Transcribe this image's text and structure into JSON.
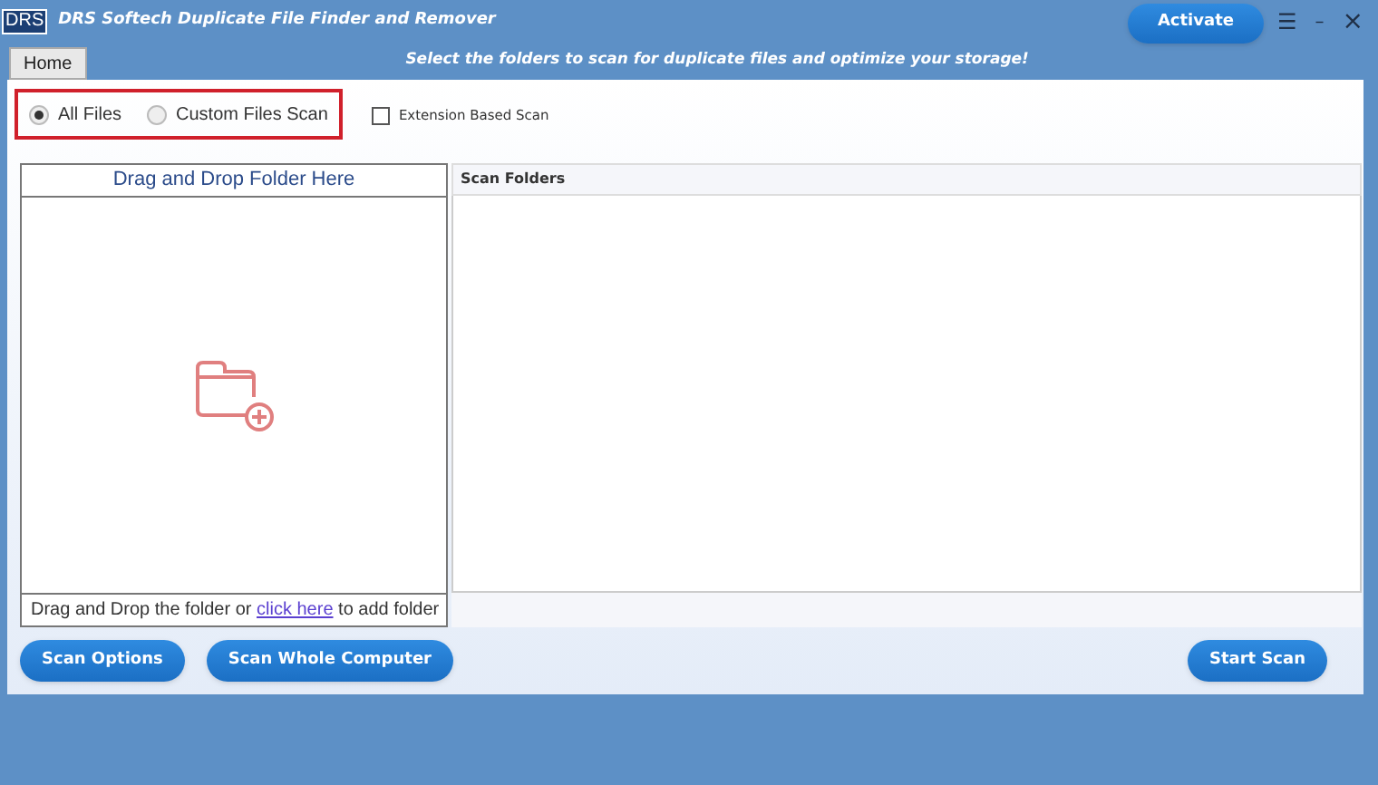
{
  "window": {
    "logo": "DRS",
    "title": "DRS Softech Duplicate File Finder and Remover",
    "activate_button": "Activate",
    "menu_icon": "☰",
    "minimize_icon": "–",
    "close_icon": "×"
  },
  "home_tab": {
    "label": "Home",
    "selected": true
  },
  "tagline": "Select the folders to scan for duplicate files and optimize your storage!",
  "scan_modes": [
    {
      "label": "All Files",
      "selected": true
    },
    {
      "label": "Custom Files Scan",
      "selected": false
    }
  ],
  "extension_scan": {
    "label": "Extension Based Scan",
    "checked": false
  },
  "drop_panel": {
    "title": "Drag and Drop Folder Here",
    "footer_before": "Drag and Drop the folder or ",
    "link": " click here",
    "footer_after": " to add folder"
  },
  "scan_folders": {
    "title": "Scan Folders"
  },
  "buttons": [
    {
      "label": "Scan Options",
      "kind": "left"
    },
    {
      "label": "Scan Whole Computer",
      "kind": "left"
    },
    {
      "label": "Start Scan",
      "kind": "right"
    }
  ]
}
